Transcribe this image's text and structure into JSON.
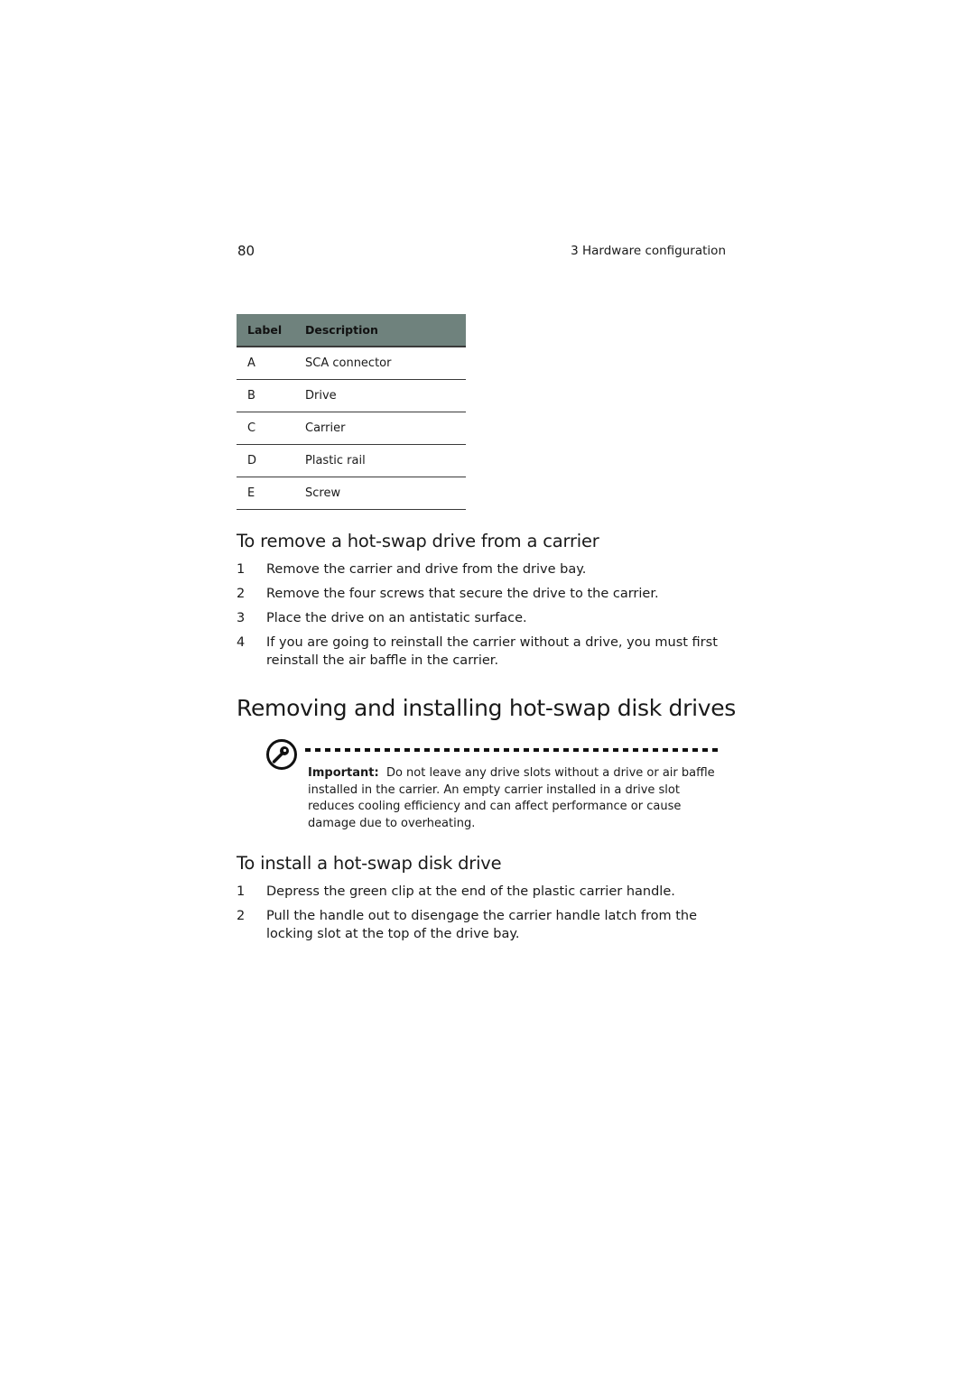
{
  "header": {
    "page_number": "80",
    "chapter": "3 Hardware configuration"
  },
  "label_table": {
    "columns": [
      "Label",
      "Description"
    ],
    "rows": [
      {
        "label": "A",
        "description": "SCA connector"
      },
      {
        "label": "B",
        "description": "Drive"
      },
      {
        "label": "C",
        "description": "Carrier"
      },
      {
        "label": "D",
        "description": "Plastic rail"
      },
      {
        "label": "E",
        "description": "Screw"
      }
    ]
  },
  "remove_section": {
    "title": "To remove a hot-swap drive from a carrier",
    "steps": [
      {
        "num": "1",
        "text": "Remove the carrier and drive from the drive bay."
      },
      {
        "num": "2",
        "text": "Remove the four screws that secure the drive to the carrier."
      },
      {
        "num": "3",
        "text": "Place the drive on an antistatic surface."
      },
      {
        "num": "4",
        "text": "If you are going to reinstall the carrier without a drive, you must first reinstall the air baffle in the carrier."
      }
    ]
  },
  "main_section": {
    "title": "Removing and installing hot-swap disk drives"
  },
  "note": {
    "icon": "key-icon",
    "label": "Important:",
    "text": "Do not leave any drive slots without a drive or air baffle installed in the carrier.  An empty carrier installed in a drive slot reduces cooling efficiency and can affect performance or cause damage due to overheating."
  },
  "install_section": {
    "title": "To install a hot-swap disk drive",
    "steps": [
      {
        "num": "1",
        "text": "Depress the green clip at the end of the plastic carrier handle."
      },
      {
        "num": "2",
        "text": "Pull the handle out to disengage the carrier handle latch from the locking slot at the top of the drive bay."
      }
    ]
  },
  "colors": {
    "table_header_bg": "#6f827d",
    "text": "#1a1a1a"
  }
}
